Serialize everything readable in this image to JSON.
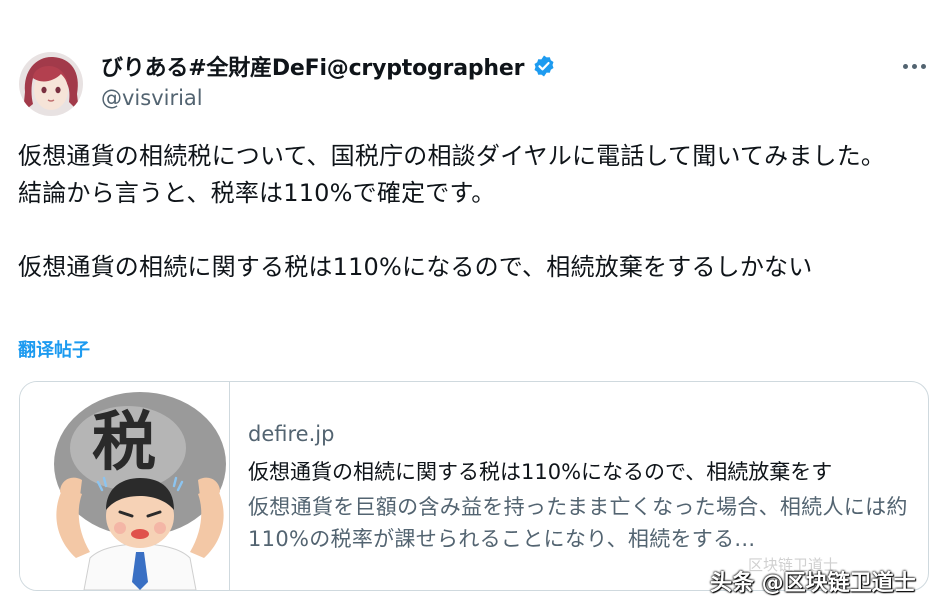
{
  "author": {
    "display_name": "びりある#全財産DeFi@cryptographer",
    "handle": "@visvirial"
  },
  "tweet": {
    "text": "仮想通貨の相続税について、国税庁の相談ダイヤルに電話して聞いてみました。\n結論から言うと、税率は110%で確定です。\n\n仮想通貨の相続に関する税は110%になるので、相続放棄をするしかない",
    "translate_label": "翻译帖子"
  },
  "card": {
    "thumbnail_text": "税",
    "domain": "defire.jp",
    "title": "仮想通貨の相続に関する税は110%になるので、相続放棄をす",
    "description": "仮想通貨を巨額の含み益を持ったまま亡くなった場合、相続人には約110%の税率が課せられることになり、相続をする..."
  },
  "watermark": {
    "small": "区块链卫道士",
    "main": "头条 @区块链卫道士"
  },
  "icons": {
    "verified": "verified-badge-icon",
    "more": "more-options-icon"
  },
  "colors": {
    "accent": "#1d9bf0",
    "text": "#0f1419",
    "secondary": "#536471",
    "border": "#cfd9de"
  }
}
